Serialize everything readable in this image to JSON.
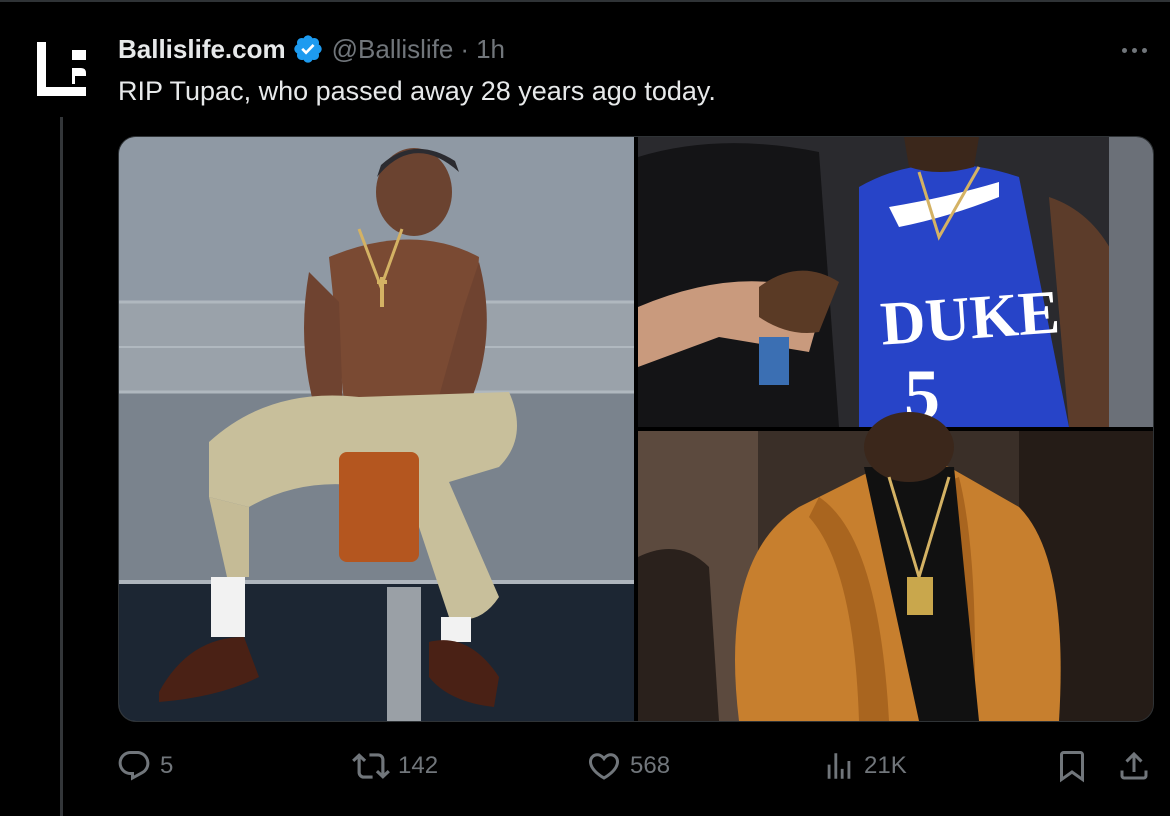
{
  "tweet": {
    "author": {
      "display_name": "Ballislife.com",
      "handle": "@Ballislife",
      "verified": true,
      "avatar_icon": "ballislife-logo-icon"
    },
    "separator": "·",
    "timestamp": "1h",
    "text": "RIP Tupac, who passed away 28 years ago today.",
    "media": {
      "count": 3,
      "items": [
        {
          "label": "photo-tupac-sitting-shirtless"
        },
        {
          "label": "photo-handshake-duke-jersey"
        },
        {
          "label": "photo-orange-leather-jacket"
        }
      ]
    },
    "actions": {
      "reply_count": "5",
      "retweet_count": "142",
      "like_count": "568",
      "views_count": "21K"
    }
  },
  "colors": {
    "background": "#000000",
    "primary_text": "#e7e9ea",
    "secondary_text": "#71767b",
    "verified_blue": "#1d9bf0",
    "divider": "#2f3336"
  },
  "icons": {
    "reply": "reply-icon",
    "retweet": "retweet-icon",
    "like": "heart-icon",
    "views": "views-icon",
    "bookmark": "bookmark-icon",
    "share": "share-icon",
    "more": "more-icon",
    "verified": "verified-badge-icon"
  }
}
